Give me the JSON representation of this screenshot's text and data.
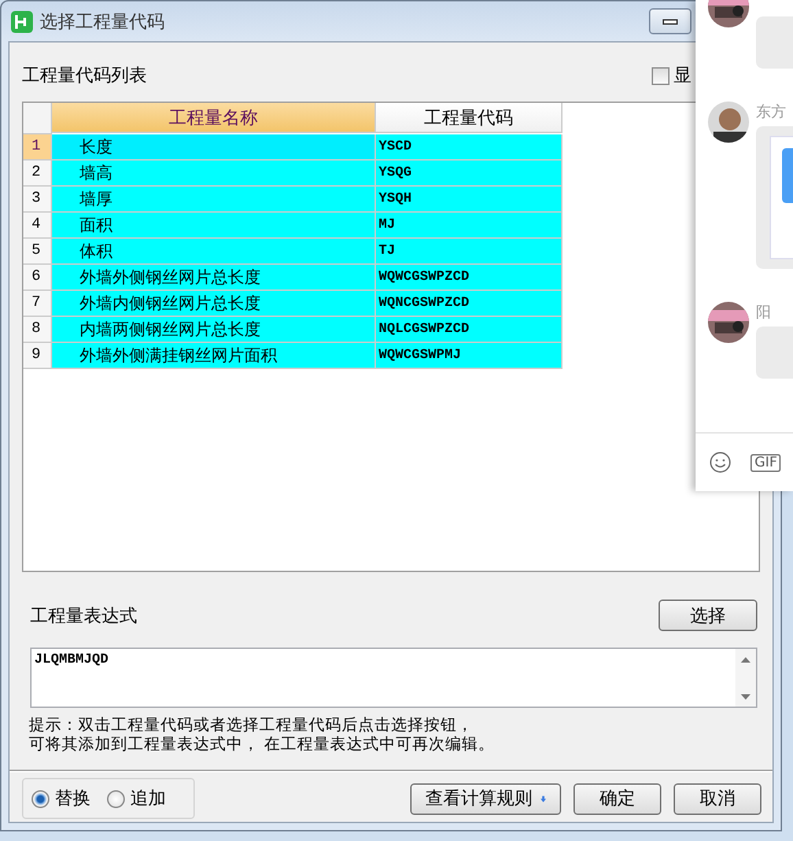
{
  "window": {
    "title": "选择工程量代码"
  },
  "list_label": "工程量代码列表",
  "show_checkbox": {
    "label": "显",
    "checked": false
  },
  "table": {
    "columns": [
      {
        "label": "工程量名称",
        "selected": true
      },
      {
        "label": "工程量代码",
        "selected": false
      }
    ],
    "rows": [
      {
        "index": "1",
        "name": "长度",
        "code": "YSCD",
        "selected": true
      },
      {
        "index": "2",
        "name": "墙高",
        "code": "YSQG",
        "selected": false
      },
      {
        "index": "3",
        "name": "墙厚",
        "code": "YSQH",
        "selected": false
      },
      {
        "index": "4",
        "name": "面积",
        "code": "MJ",
        "selected": false
      },
      {
        "index": "5",
        "name": "体积",
        "code": "TJ",
        "selected": false
      },
      {
        "index": "6",
        "name": "外墙外侧钢丝网片总长度",
        "code": "WQWCGSWPZCD",
        "selected": false
      },
      {
        "index": "7",
        "name": "外墙内侧钢丝网片总长度",
        "code": "WQNCGSWPZCD",
        "selected": false
      },
      {
        "index": "8",
        "name": "内墙两侧钢丝网片总长度",
        "code": "NQLCGSWPZCD",
        "selected": false
      },
      {
        "index": "9",
        "name": "外墙外侧满挂钢丝网片面积",
        "code": "WQWCGSWPMJ",
        "selected": false
      }
    ]
  },
  "expression": {
    "label": "工程量表达式",
    "select_button": "选择",
    "value": "JLQMBMJQD"
  },
  "hint": [
    "提示：双击工程量代码或者选择工程量代码后点击选择按钮，",
    "可将其添加到工程量表达式中， 在工程量表达式中可再次编辑。"
  ],
  "mode": [
    {
      "label": "替换",
      "selected": true
    },
    {
      "label": "追加",
      "selected": false
    }
  ],
  "buttons": [
    {
      "label": "查看计算规则",
      "kind": "dropdown"
    },
    {
      "label": "确定",
      "kind": "plain"
    },
    {
      "label": "取消",
      "kind": "plain"
    }
  ],
  "chat": {
    "messages": [
      {
        "kind": "bubble"
      },
      {
        "kind": "card",
        "name": "东方"
      },
      {
        "kind": "bubble",
        "name": "阳"
      }
    ],
    "gif_label": "GIF"
  }
}
